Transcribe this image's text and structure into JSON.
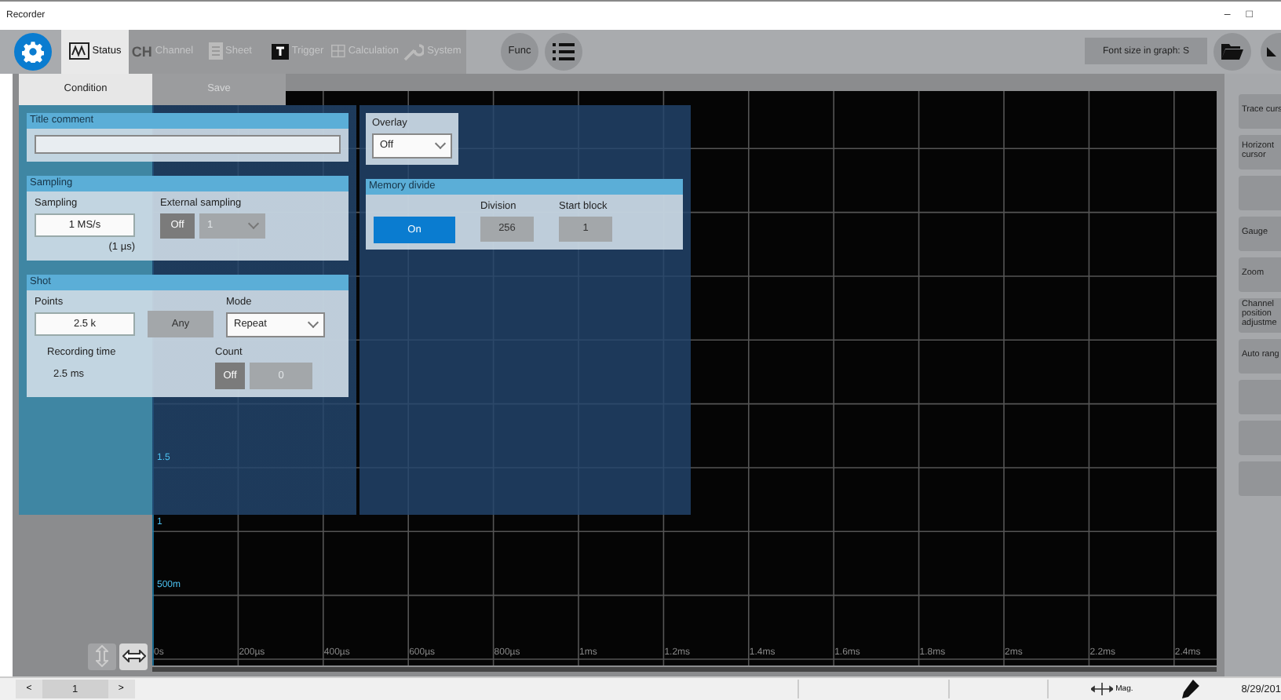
{
  "window": {
    "title": "Recorder",
    "controls": [
      "–",
      "□"
    ]
  },
  "toolbar": {
    "tabs": [
      {
        "label": "Status",
        "selected": true
      },
      {
        "label": "Channel",
        "mark": "CH",
        "selected": false
      },
      {
        "label": "Sheet",
        "selected": false
      },
      {
        "label": "Trigger",
        "selected": false
      },
      {
        "label": "Calculation",
        "selected": false
      },
      {
        "label": "System",
        "selected": false
      }
    ],
    "func": "Func",
    "font_size": "Font size in graph: S"
  },
  "subtabs": [
    {
      "label": "Condition",
      "selected": true
    },
    {
      "label": "Save",
      "selected": false
    }
  ],
  "title_comment": {
    "heading": "Title comment"
  },
  "sampling": {
    "heading": "Sampling",
    "label": "Sampling",
    "value": "1 MS/s",
    "period": "(1 µs)",
    "external_label": "External sampling",
    "external": {
      "label": "Off",
      "on": false
    },
    "external_value": {
      "value": "1",
      "disabled": true
    }
  },
  "shot": {
    "heading": "Shot",
    "points_label": "Points",
    "points": "2.5 k",
    "any": "Any",
    "mode_label": "Mode",
    "mode": "Repeat",
    "recording_label": "Recording time",
    "recording": "2.5 ms",
    "count_label": "Count",
    "count": {
      "label": "Off",
      "on": false
    },
    "count_value": {
      "value": "0",
      "disabled": true
    }
  },
  "overlay": {
    "heading": "Overlay",
    "value": "Off"
  },
  "memory_divide": {
    "heading": "Memory divide",
    "toggle": {
      "label": "On",
      "on": true
    },
    "division_label": "Division",
    "division": "256",
    "start_label": "Start block",
    "start": "1"
  },
  "graph": {
    "y_labels": [
      "1.5",
      "1",
      "500m"
    ],
    "x_labels": [
      "0s",
      "200µs",
      "400µs",
      "600µs",
      "800µs",
      "1ms",
      "1.2ms",
      "1.4ms",
      "1.6ms",
      "1.8ms",
      "2ms",
      "2.2ms",
      "2.4ms"
    ]
  },
  "side_buttons": [
    {
      "kind": "labeled",
      "label": "Trace curs"
    },
    {
      "kind": "labeled",
      "label": "Horizont cursor"
    },
    {
      "kind": "blank"
    },
    {
      "kind": "labeled",
      "label": "Gauge"
    },
    {
      "kind": "labeled",
      "label": "Zoom"
    },
    {
      "kind": "labeled",
      "label": "Channel position adjustme"
    },
    {
      "kind": "labeled",
      "label": "Auto rang"
    },
    {
      "kind": "blank"
    },
    {
      "kind": "blank"
    },
    {
      "kind": "blank"
    }
  ],
  "status_bar": {
    "prev": "<",
    "page": "1",
    "next": ">",
    "mag": "Mag.",
    "date": "8/29/201"
  }
}
